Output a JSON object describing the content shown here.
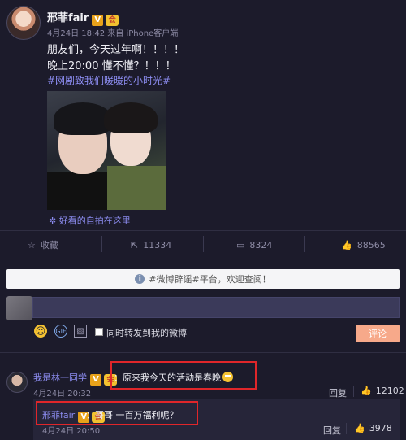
{
  "post": {
    "username": "邢菲fair",
    "timestamp": "4月24日 18:42",
    "source": "来自 iPhone客户端",
    "lines": [
      "朋友们，今天过年啊！！！！",
      "晚上20:00 懂不懂？！！！"
    ],
    "hashtag": "#网剧致我们暖暖的小时光#",
    "photo_caption": "好看的自拍在这里"
  },
  "actions": {
    "favorite": "收藏",
    "repost_count": "11334",
    "comment_count": "8324",
    "like_count": "88565"
  },
  "notice": "#微博辟谣#平台，欢迎查阅！",
  "composer": {
    "forward_label": "同时转发到我的微博",
    "submit_label": "评论"
  },
  "comments": [
    {
      "user": "我是林一同学",
      "text": "：原来我今天的活动是春晚",
      "time": "4月24日 20:32",
      "reply": "回复",
      "likes": "12102"
    }
  ],
  "nested_reply": {
    "user": "邢菲fair",
    "text": "：哥哥 一百万福利呢？",
    "time": "4月24日 20:50",
    "reply": "回复",
    "likes": "3978"
  },
  "badges": {
    "verified": "V",
    "crown": "会"
  },
  "colors": {
    "background": "#1c1b2b",
    "link": "#8c8cf0",
    "highlight_box": "#e0262a",
    "submit_button": "#f7a98a"
  }
}
